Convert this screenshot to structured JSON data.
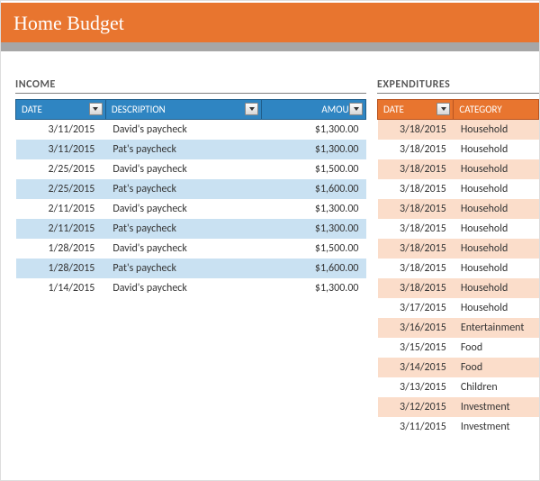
{
  "title": "Home Budget",
  "income": {
    "section": "INCOME",
    "headers": {
      "date": "DATE",
      "desc": "DESCRIPTION",
      "amount": "AMOUNT"
    },
    "rows": [
      {
        "date": "3/11/2015",
        "desc": "David's paycheck",
        "amount": "$1,300.00"
      },
      {
        "date": "3/11/2015",
        "desc": "Pat's paycheck",
        "amount": "$1,300.00"
      },
      {
        "date": "2/25/2015",
        "desc": "David's paycheck",
        "amount": "$1,500.00"
      },
      {
        "date": "2/25/2015",
        "desc": "Pat's paycheck",
        "amount": "$1,600.00"
      },
      {
        "date": "2/11/2015",
        "desc": "David's paycheck",
        "amount": "$1,300.00"
      },
      {
        "date": "2/11/2015",
        "desc": "Pat's paycheck",
        "amount": "$1,300.00"
      },
      {
        "date": "1/28/2015",
        "desc": "David's paycheck",
        "amount": "$1,500.00"
      },
      {
        "date": "1/28/2015",
        "desc": "Pat's paycheck",
        "amount": "$1,600.00"
      },
      {
        "date": "1/14/2015",
        "desc": "David's paycheck",
        "amount": "$1,300.00"
      }
    ]
  },
  "expend": {
    "section": "EXPENDITURES",
    "headers": {
      "date": "DATE",
      "cat": "CATEGORY"
    },
    "rows": [
      {
        "date": "3/18/2015",
        "cat": "Household"
      },
      {
        "date": "3/18/2015",
        "cat": "Household"
      },
      {
        "date": "3/18/2015",
        "cat": "Household"
      },
      {
        "date": "3/18/2015",
        "cat": "Household"
      },
      {
        "date": "3/18/2015",
        "cat": "Household"
      },
      {
        "date": "3/18/2015",
        "cat": "Household"
      },
      {
        "date": "3/18/2015",
        "cat": "Household"
      },
      {
        "date": "3/18/2015",
        "cat": "Household"
      },
      {
        "date": "3/18/2015",
        "cat": "Household"
      },
      {
        "date": "3/17/2015",
        "cat": "Household"
      },
      {
        "date": "3/16/2015",
        "cat": "Entertainment"
      },
      {
        "date": "3/15/2015",
        "cat": "Food"
      },
      {
        "date": "3/14/2015",
        "cat": "Food"
      },
      {
        "date": "3/13/2015",
        "cat": "Children"
      },
      {
        "date": "3/12/2015",
        "cat": "Investment"
      },
      {
        "date": "3/11/2015",
        "cat": "Investment"
      }
    ]
  }
}
